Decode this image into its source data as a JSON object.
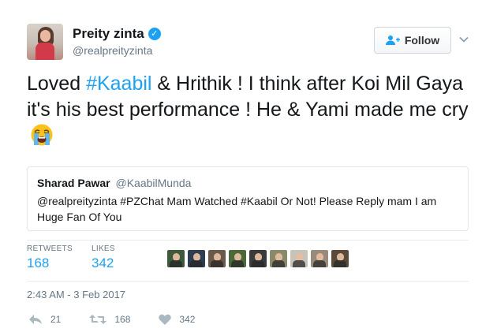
{
  "author": {
    "name": "Preity zinta",
    "handle": "@realpreityzinta",
    "verified": true
  },
  "follow_button": {
    "label": "Follow"
  },
  "tweet": {
    "segments": [
      {
        "text": "Loved ",
        "type": "text"
      },
      {
        "text": "#Kaabil",
        "type": "hashtag"
      },
      {
        "text": " & Hrithik ! I think after Koi Mil Gaya it's his best performance ! He & Yami made me cry",
        "type": "text"
      }
    ],
    "emoji": "loudly-crying-face"
  },
  "quoted_tweet": {
    "name": "Sharad Pawar",
    "handle": "@KaabilMunda",
    "text": "@realpreityzinta #PZChat Mam Watched #Kaabil Or Not! Please Reply mam I am Huge Fan Of You"
  },
  "stats": {
    "retweets_label": "RETWEETS",
    "retweets": "168",
    "likes_label": "LIKES",
    "likes": "342"
  },
  "likers_count_shown": 9,
  "timestamp": "2:43 AM - 3 Feb 2017",
  "actions": {
    "reply_count": "21",
    "retweet_count": "168",
    "like_count": "342"
  },
  "colors": {
    "accent": "#1da1f2",
    "muted": "#657786",
    "text": "#14171a",
    "border": "#e1e8ed"
  }
}
